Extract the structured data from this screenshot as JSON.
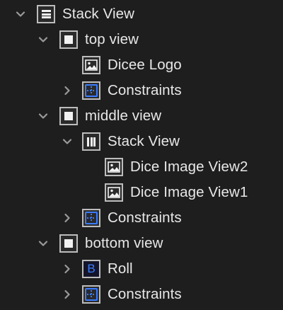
{
  "outline": {
    "items": [
      {
        "label": "Stack View",
        "expanded": true,
        "icon": "vertical-stack-view-icon"
      },
      {
        "label": "top view",
        "expanded": true,
        "icon": "view-icon"
      },
      {
        "label": "Dicee Logo",
        "icon": "image-view-icon"
      },
      {
        "label": "Constraints",
        "expanded": false,
        "icon": "constraints-icon"
      },
      {
        "label": "middle view",
        "expanded": true,
        "icon": "view-icon"
      },
      {
        "label": "Stack View",
        "expanded": true,
        "icon": "horizontal-stack-view-icon"
      },
      {
        "label": "Dice Image View2",
        "icon": "image-view-icon"
      },
      {
        "label": "Dice Image View1",
        "icon": "image-view-icon"
      },
      {
        "label": "Constraints",
        "expanded": false,
        "icon": "constraints-icon"
      },
      {
        "label": "bottom view",
        "expanded": true,
        "icon": "view-icon"
      },
      {
        "label": "Roll",
        "icon": "button-icon",
        "glyph": "B"
      },
      {
        "label": "Constraints",
        "expanded": false,
        "icon": "constraints-icon"
      }
    ]
  },
  "colors": {
    "background": "#1e1e1e",
    "text": "#e8e8e8",
    "accent_blue": "#3b7cff",
    "chevron": "#9a9a9a"
  }
}
